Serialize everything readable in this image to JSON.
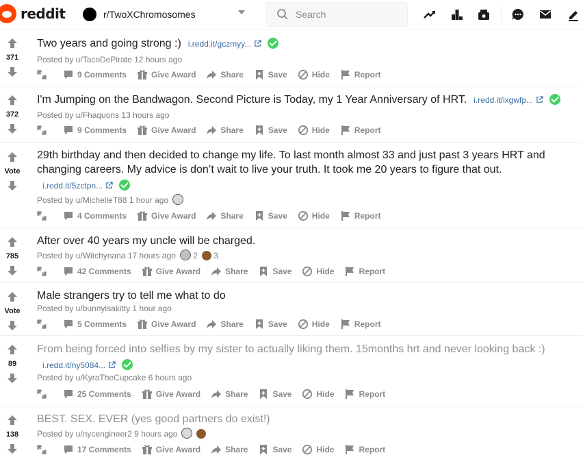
{
  "header": {
    "logo_text": "reddit",
    "community": "r/TwoXChromosomes",
    "search_placeholder": "Search"
  },
  "actions": {
    "share": "Share",
    "save": "Save",
    "hide": "Hide",
    "report": "Report",
    "give_award": "Give Award"
  },
  "colors": {
    "accent": "#ff4500",
    "check": "#46d160",
    "link": "#3c6da0"
  },
  "posts": [
    {
      "score": "371",
      "title": "Two years and going strong :)",
      "link": "i.redd.it/gczmyy...",
      "meta": "Posted by u/TacoDePirate 12 hours ago",
      "comments": "9 Comments"
    },
    {
      "score": "372",
      "title": "I'm Jumping on the Bandwagon. Second Picture is Today, my 1 Year Anniversary of HRT.",
      "link": "i.redd.it/ixgwfp...",
      "meta": "Posted by u/Fhaquons 13 hours ago",
      "comments": "9 Comments"
    },
    {
      "score": "Vote",
      "title_line1": "29th birthday and then decided to change my life. To last month almost 33 and just past 3 years HRT and",
      "title_line2": "changing careers. My advice is don’t wait to live your truth. It took me 20 years to figure that out.",
      "link": "i.redd.it/5zctpn...",
      "meta": "Posted by u/MichelleT88 1 hour ago",
      "comments": "4 Comments"
    },
    {
      "score": "785",
      "title": "After over 40 years my uncle will be charged.",
      "meta": "Posted by u/Witchynana 17 hours ago",
      "award1_count": "2",
      "award2_count": "3",
      "comments": "42 Comments"
    },
    {
      "score": "Vote",
      "title": "Male strangers try to tell me what to do",
      "meta": "Posted by u/bunnyisakitty 1 hour ago",
      "comments": "5 Comments"
    },
    {
      "score": "89",
      "title": "From being forced into selfies by my sister to actually liking them. 15months hrt and never looking back :)",
      "link": "i.redd.it/ny5084...",
      "meta": "Posted by u/KyraTheCupcake 6 hours ago",
      "comments": "25 Comments"
    },
    {
      "score": "138",
      "title": "BEST. SEX. EVER (yes good partners do exist!)",
      "meta": "Posted by u/nycengineer2 9 hours ago",
      "comments": "17 Comments"
    }
  ]
}
